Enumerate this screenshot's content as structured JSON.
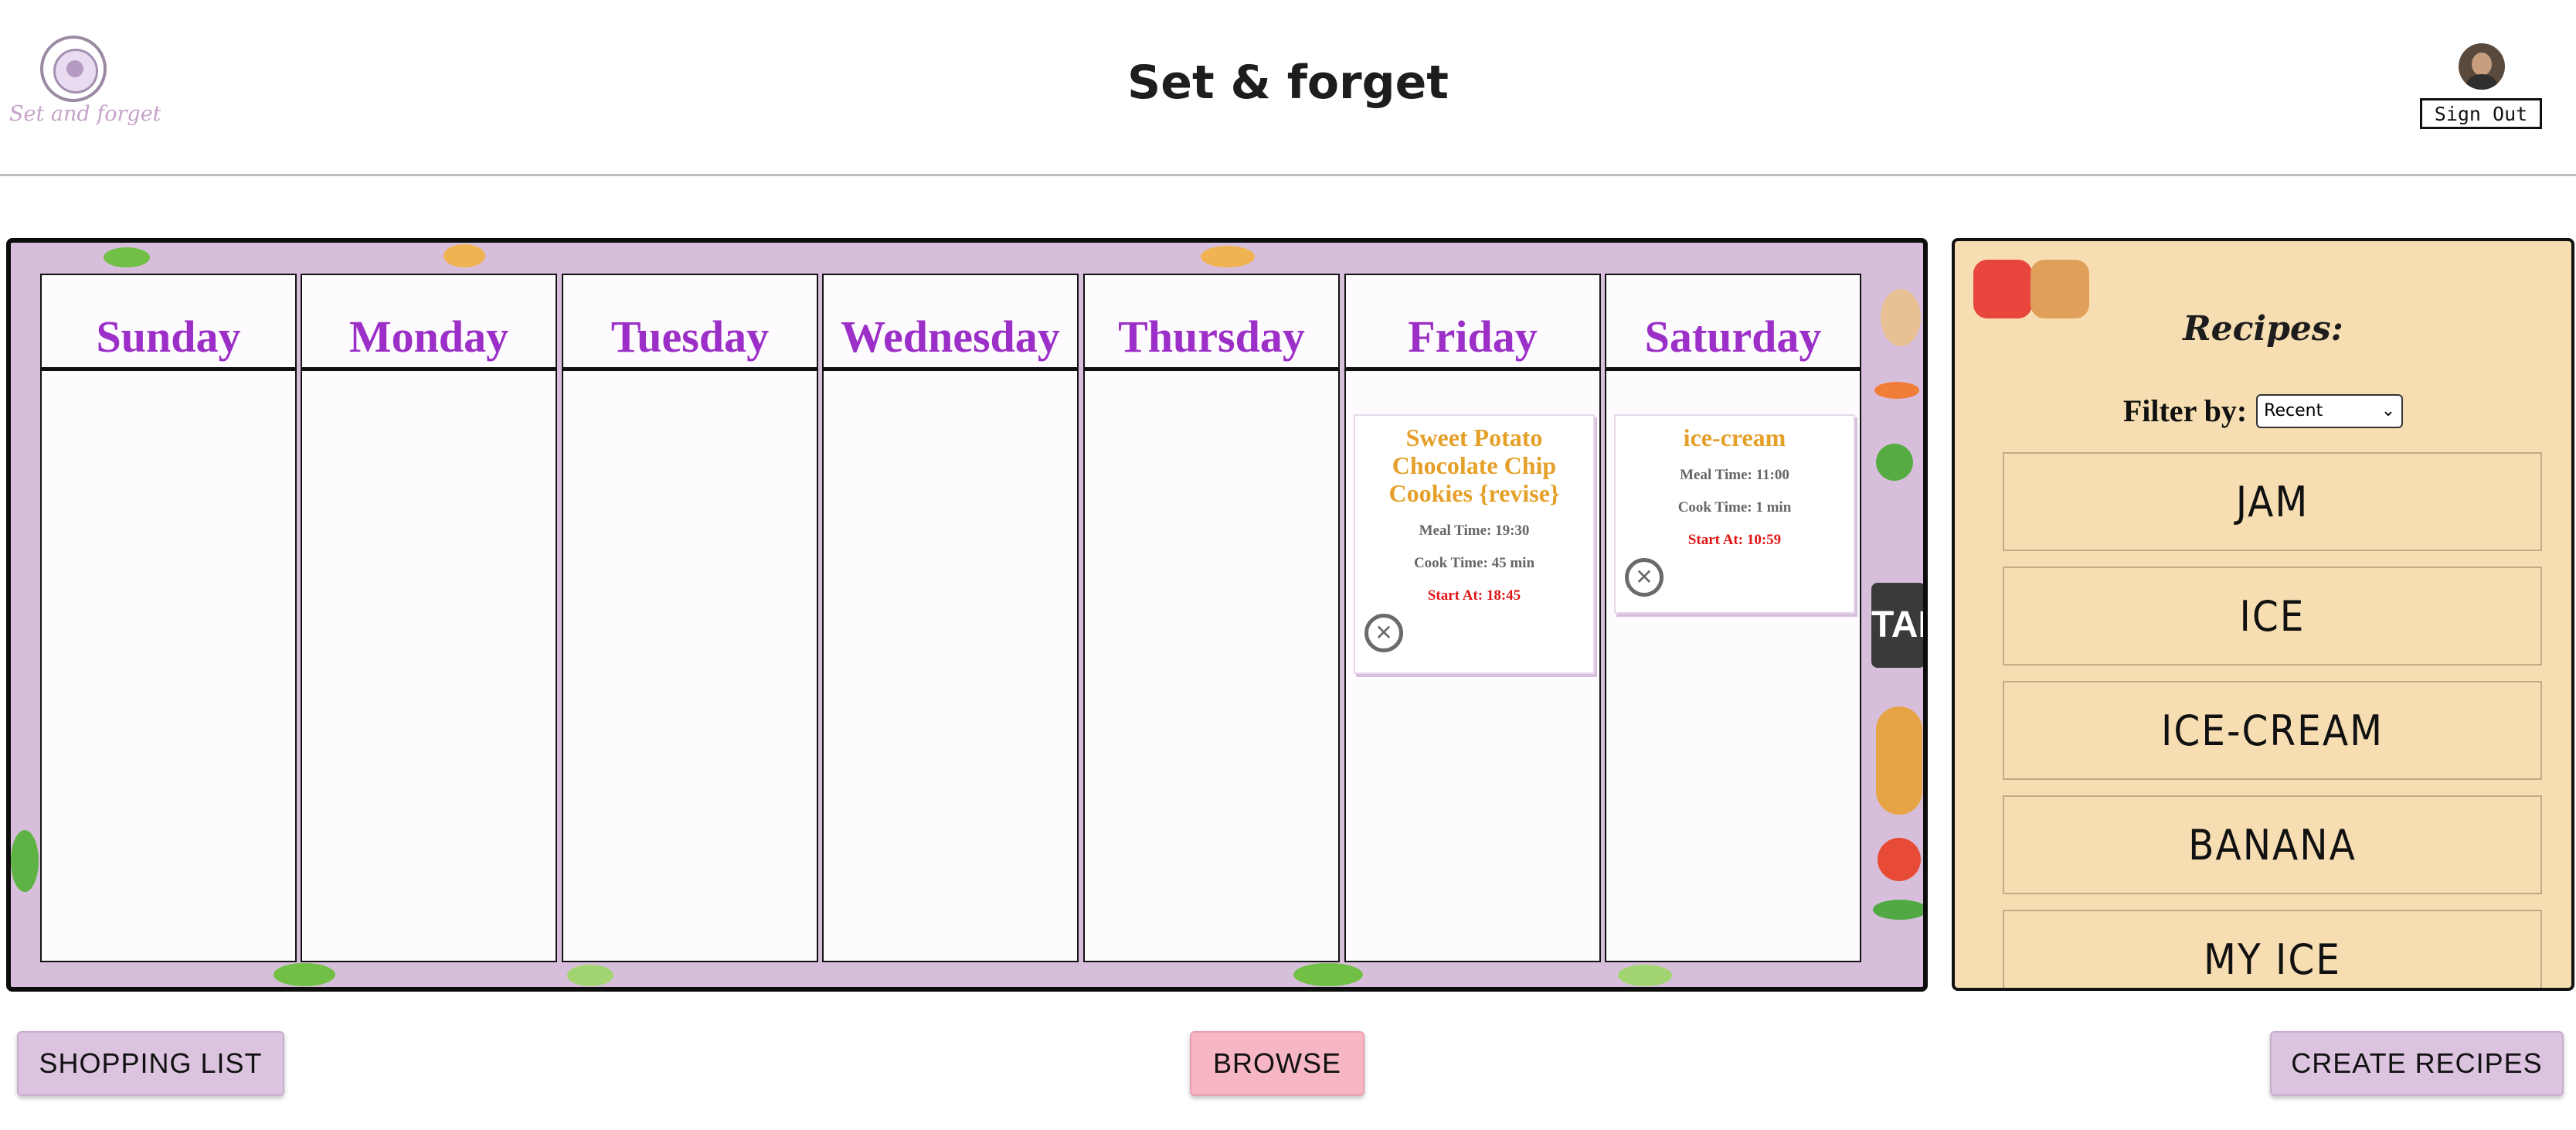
{
  "header": {
    "logo_text": "Set and forget",
    "title": "Set & forget",
    "sign_out_label": "Sign Out"
  },
  "planner": {
    "days": [
      {
        "name": "Sunday",
        "meals": []
      },
      {
        "name": "Monday",
        "meals": []
      },
      {
        "name": "Tuesday",
        "meals": []
      },
      {
        "name": "Wednesday",
        "meals": []
      },
      {
        "name": "Thursday",
        "meals": []
      },
      {
        "name": "Friday",
        "meals": [
          {
            "title": "Sweet Potato Chocolate Chip Cookies {revise}",
            "meal_time": "Meal Time: 19:30",
            "cook_time": "Cook Time: 45 min",
            "start_at": "Start At: 18:45"
          }
        ]
      },
      {
        "name": "Saturday",
        "meals": [
          {
            "title": "ice-cream",
            "meal_time": "Meal Time: 11:00",
            "cook_time": "Cook Time: 1 min",
            "start_at": "Start At: 10:59"
          }
        ]
      }
    ]
  },
  "recipes": {
    "title": "Recipes:",
    "filter_label": "Filter by:",
    "filter_selected": "Recent",
    "items": [
      "JAM",
      "ICE",
      "ICE-CREAM",
      "BANANA",
      "MY ICE"
    ]
  },
  "actions": {
    "shopping_list": "SHOPPING LIST",
    "browse": "BROWSE",
    "create_recipes": "CREATE RECIPES"
  },
  "colors": {
    "day_heading": "#9b2fc7",
    "meal_title": "#e5a02a",
    "start_at": "#e01414",
    "planner_bg": "#d7bfdc",
    "recipes_bg": "#f6ddb2",
    "lavender_button": "#dcc3e0",
    "pink_button": "#f7b6c4"
  }
}
